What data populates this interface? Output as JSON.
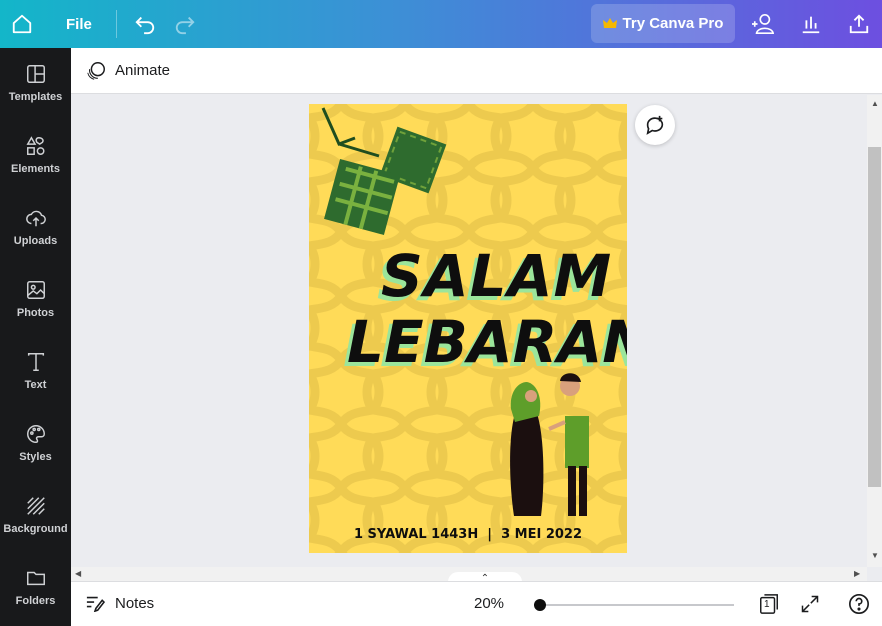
{
  "topbar": {
    "file_label": "File",
    "pro_label": "Try Canva Pro",
    "colors": {
      "gradient_start": "#13b6c9",
      "gradient_end": "#6d4fe0",
      "crown": "#f5b800"
    }
  },
  "sidebar": {
    "items": [
      {
        "label": "Templates",
        "icon": "templates-icon"
      },
      {
        "label": "Elements",
        "icon": "elements-icon"
      },
      {
        "label": "Uploads",
        "icon": "uploads-icon"
      },
      {
        "label": "Photos",
        "icon": "photos-icon"
      },
      {
        "label": "Text",
        "icon": "text-icon"
      },
      {
        "label": "Styles",
        "icon": "styles-icon"
      },
      {
        "label": "Background",
        "icon": "background-icon"
      },
      {
        "label": "Folders",
        "icon": "folders-icon"
      }
    ]
  },
  "toolbar": {
    "animate_label": "Animate"
  },
  "design": {
    "title_line1": "SALAM",
    "title_line2": "LEBARAN",
    "date_text": "1 SYAWAL 1443H  |  3 MEI 2022",
    "colors": {
      "background": "#ffdb58",
      "pattern": "#e8c84a",
      "ketupat": "#2e6b2e",
      "text_glow": "#9be59b"
    }
  },
  "footer": {
    "notes_label": "Notes",
    "zoom_label": "20%",
    "zoom_level_percent": 20,
    "page_count": "1"
  }
}
